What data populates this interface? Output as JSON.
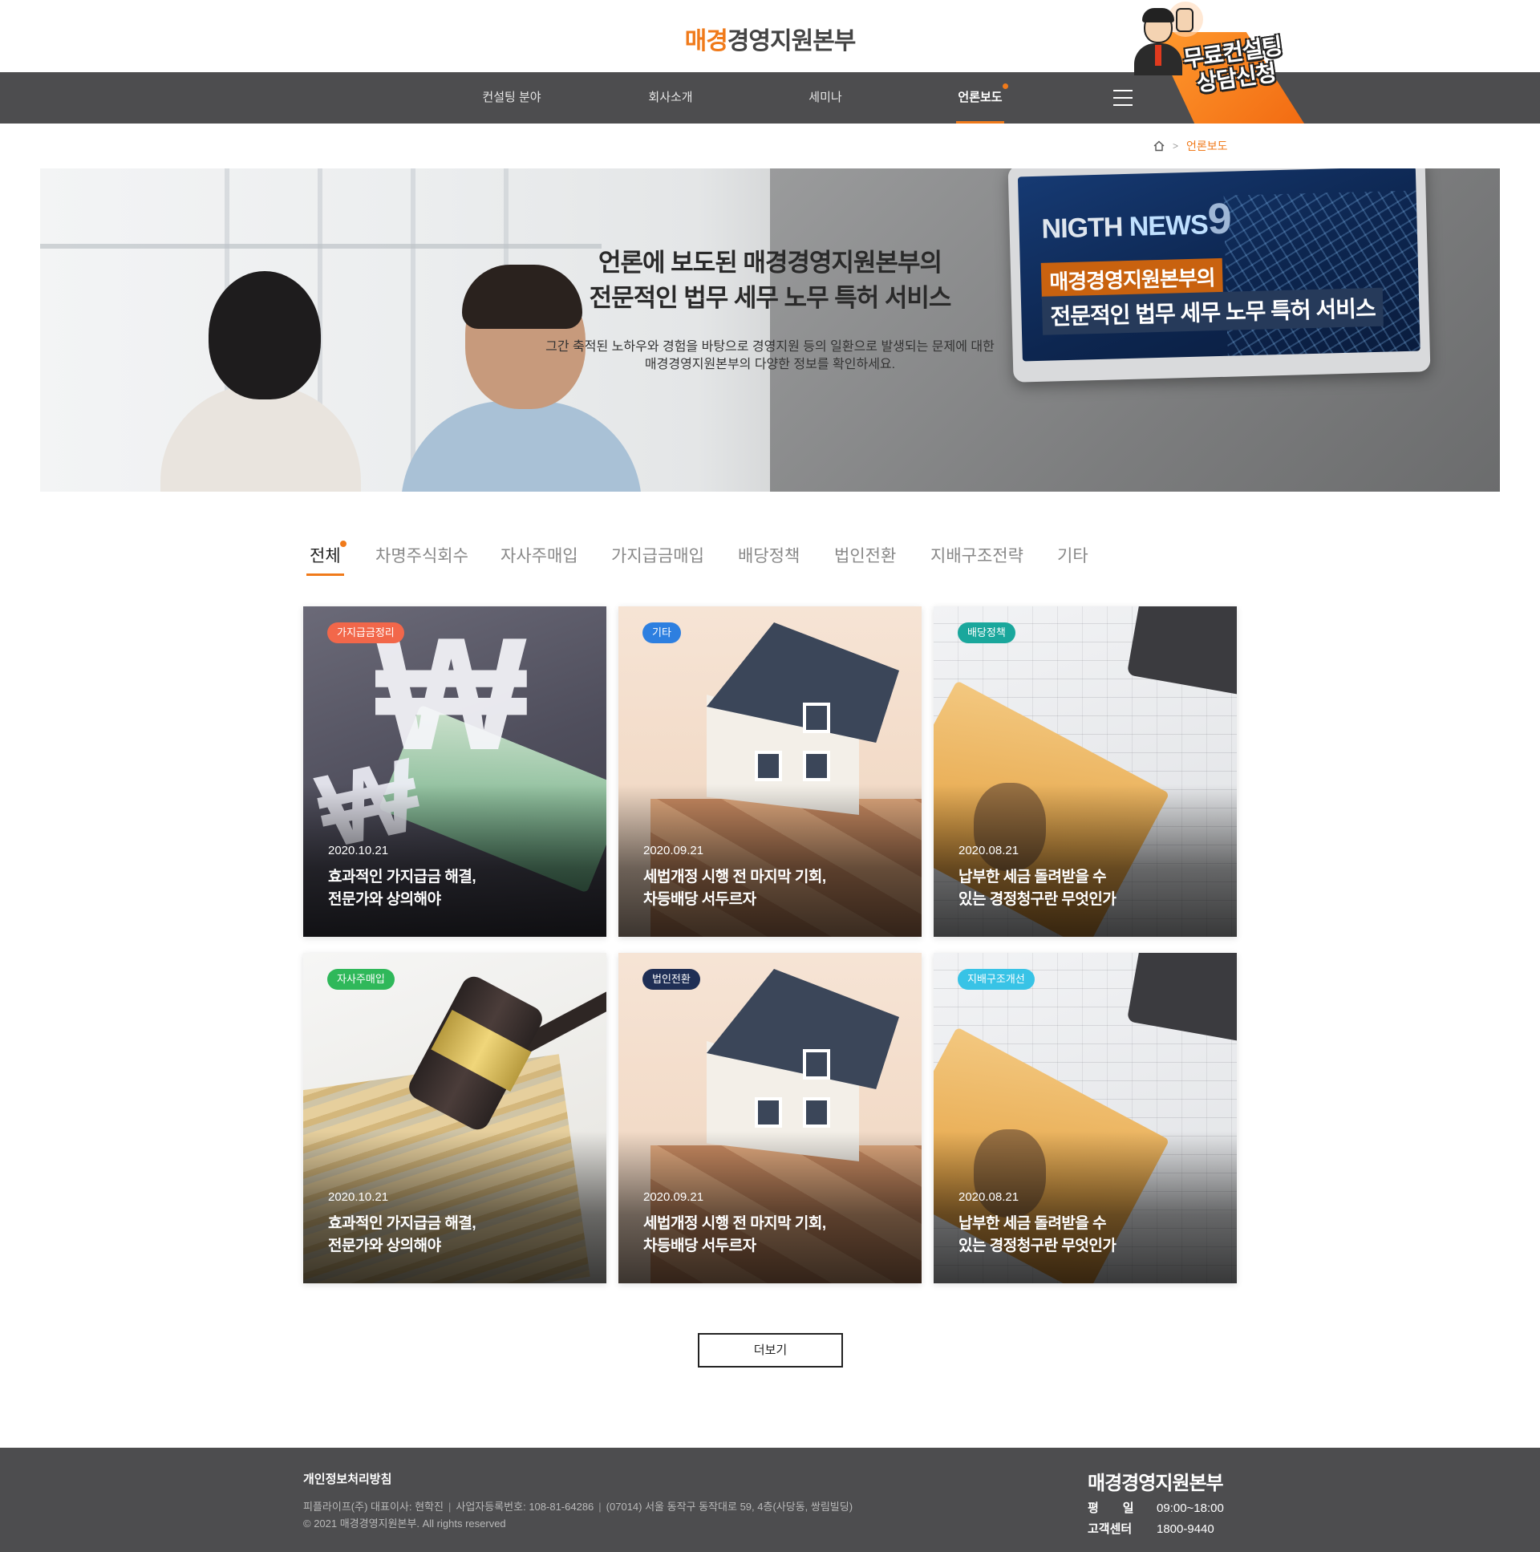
{
  "header": {
    "logo_accent": "매경",
    "logo_rest": "경영지원본부",
    "promo_line1": "무료컨설팅",
    "promo_line2": "상담신청"
  },
  "nav": {
    "items": [
      {
        "label": "컨설팅 분야",
        "active": false
      },
      {
        "label": "회사소개",
        "active": false
      },
      {
        "label": "세미나",
        "active": false
      },
      {
        "label": "언론보도",
        "active": true
      }
    ]
  },
  "breadcrumb": {
    "current": "언론보도"
  },
  "hero": {
    "title_line1": "언론에 보도된 매경경영지원본부의",
    "title_line2": "전문적인 법무 세무 노무 특허 서비스",
    "desc_line1": "그간 축적된 노하우와 경험을 바탕으로 경영지원 등의 일환으로 발생되는 문제에 대한",
    "desc_line2": "매경경영지원본부의 다양한 정보를 확인하세요.",
    "tv_news_a": "NIGTH",
    "tv_news_b": "NEWS",
    "tv_news_num": "9",
    "tv_caption1": "매경경영지원본부의",
    "tv_caption2": "전문적인 법무 세무 노무 특허 서비스"
  },
  "tabs": [
    {
      "label": "전체",
      "active": true
    },
    {
      "label": "차명주식회수",
      "active": false
    },
    {
      "label": "자사주매입",
      "active": false
    },
    {
      "label": "가지급금매입",
      "active": false
    },
    {
      "label": "배당정책",
      "active": false
    },
    {
      "label": "법인전환",
      "active": false
    },
    {
      "label": "지배구조전략",
      "active": false
    },
    {
      "label": "기타",
      "active": false
    }
  ],
  "cards": [
    {
      "badge": "가지급금정리",
      "badge_color": "#f2674a",
      "date": "2020.10.21",
      "title_line1": "효과적인 가지급금 해결,",
      "title_line2": "전문가와 상의해야",
      "image": "won-symbol"
    },
    {
      "badge": "기타",
      "badge_color": "#2d7fe0",
      "date": "2020.09.21",
      "title_line1": "세법개정 시행 전 마지막 기회,",
      "title_line2": "차등배당 서두르자",
      "image": "house"
    },
    {
      "badge": "배당정책",
      "badge_color": "#1aa79c",
      "date": "2020.08.21",
      "title_line1": "납부한 세금 돌려받을 수",
      "title_line2": "있는 경정청구란 무엇인가",
      "image": "banknote-chart"
    },
    {
      "badge": "자사주매입",
      "badge_color": "#2fb85a",
      "date": "2020.10.21",
      "title_line1": "효과적인 가지급금 해결,",
      "title_line2": "전문가와 상의해야",
      "image": "gavel"
    },
    {
      "badge": "법인전환",
      "badge_color": "#1f2f55",
      "date": "2020.09.21",
      "title_line1": "세법개정 시행 전 마지막 기회,",
      "title_line2": "차등배당 서두르자",
      "image": "house"
    },
    {
      "badge": "지배구조개선",
      "badge_color": "#38c3e6",
      "date": "2020.08.21",
      "title_line1": "납부한 세금 돌려받을 수",
      "title_line2": "있는 경정청구란 무엇인가",
      "image": "banknote-chart"
    }
  ],
  "more_button": "더보기",
  "footer": {
    "policy": "개인정보처리방침",
    "company": "피플라이프(주) 대표이사: 현학진",
    "reg_no": "사업자등록번호: 108-81-64286",
    "address": "(07014) 서울 동작구 동작대로 59, 4층(사당동, 쌍림빌딩)",
    "copyright": "© 2021 매경경영지원본부. All rights reserved",
    "brand": "매경경영지원본부",
    "hours_label": "평　　일",
    "hours_value": "09:00~18:00",
    "cs_label": "고객센터",
    "cs_value": "1800-9440"
  },
  "colors": {
    "accent": "#f07a1a",
    "nav_bg": "#4d4d4f"
  }
}
